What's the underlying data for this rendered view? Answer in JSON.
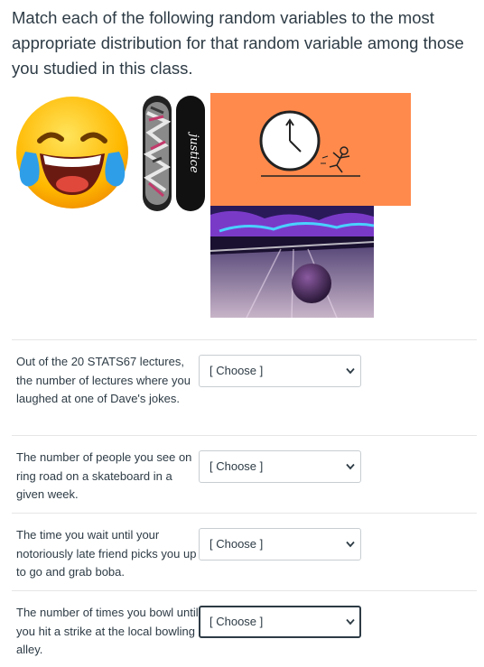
{
  "question": {
    "text": "Match each of the following random variables to the most appropriate distribution for that random variable among those you studied in this class."
  },
  "images": {
    "emoji": "laughing-crying-emoji",
    "skateboard_a_text": "justice",
    "skateboard_b_text": "justice",
    "clock": "clock-with-running-figure",
    "bowling": "bowling-alley-photo"
  },
  "colors": {
    "text": "#2d3b45",
    "clock_bg": "#ff8a4c",
    "divider": "#e6e6e6",
    "select_border": "#c7cdd1"
  },
  "matches": [
    {
      "label": "Out of the 20 STATS67 lectures, the number of lectures where you laughed at one of Dave's jokes.",
      "selected": "[ Choose ]"
    },
    {
      "label": "The number of people you see on ring road on a skateboard in a given week.",
      "selected": "[ Choose ]"
    },
    {
      "label": "The time you wait until your notoriously late friend picks you up to go and grab boba.",
      "selected": "[ Choose ]"
    },
    {
      "label": "The number of times you bowl until you hit a strike at the local bowling alley.",
      "selected": "[ Choose ]"
    }
  ]
}
